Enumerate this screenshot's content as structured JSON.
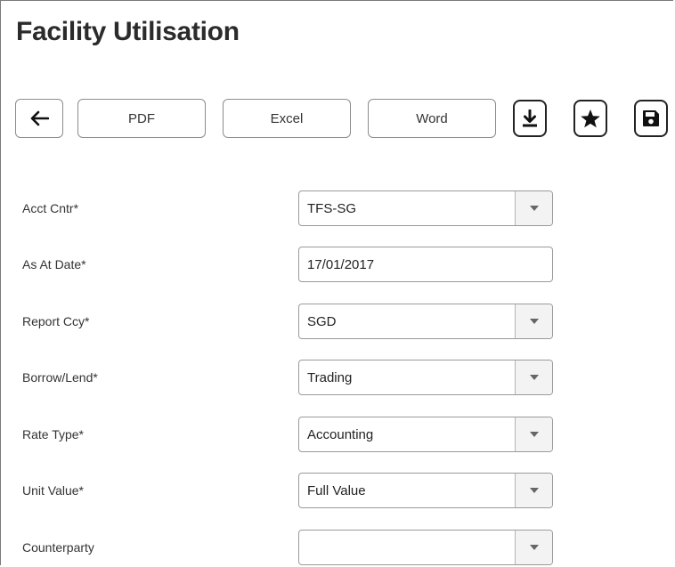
{
  "page": {
    "title": "Facility Utilisation"
  },
  "toolbar": {
    "back_icon": "arrow-left-icon",
    "pdf_label": "PDF",
    "excel_label": "Excel",
    "word_label": "Word",
    "download_icon": "download-icon",
    "favorite_icon": "star-icon",
    "save_icon": "floppy-disk-icon"
  },
  "form": {
    "acct_cntr": {
      "label": "Acct Cntr*",
      "value": "TFS-SG"
    },
    "as_at_date": {
      "label": "As At Date*",
      "value": "17/01/2017"
    },
    "report_ccy": {
      "label": "Report Ccy*",
      "value": "SGD"
    },
    "borrow_lend": {
      "label": "Borrow/Lend*",
      "value": "Trading"
    },
    "rate_type": {
      "label": "Rate Type*",
      "value": "Accounting"
    },
    "unit_value": {
      "label": "Unit Value*",
      "value": "Full Value"
    },
    "counterparty": {
      "label": "Counterparty",
      "value": ""
    }
  },
  "colors": {
    "border": "#9a9a9a",
    "dropdown_bg": "#f3f3f3",
    "title": "#2b2b2b"
  }
}
